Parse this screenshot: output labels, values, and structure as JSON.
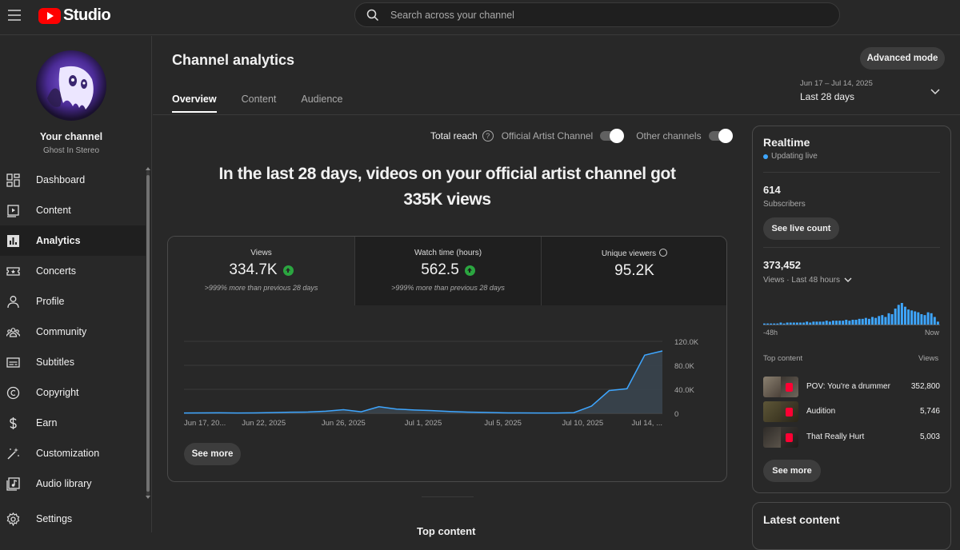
{
  "app": {
    "logo_text": "Studio",
    "search_placeholder": "Search across your channel"
  },
  "sidebar": {
    "channel_title": "Your channel",
    "channel_name": "Ghost In Stereo",
    "items": [
      {
        "label": "Dashboard",
        "icon": "dashboard-icon"
      },
      {
        "label": "Content",
        "icon": "content-icon"
      },
      {
        "label": "Analytics",
        "icon": "analytics-icon",
        "active": true
      },
      {
        "label": "Concerts",
        "icon": "ticket-icon"
      },
      {
        "label": "Profile",
        "icon": "person-icon"
      },
      {
        "label": "Community",
        "icon": "community-icon"
      },
      {
        "label": "Subtitles",
        "icon": "subtitles-icon"
      },
      {
        "label": "Copyright",
        "icon": "copyright-icon"
      },
      {
        "label": "Earn",
        "icon": "dollar-icon"
      },
      {
        "label": "Customization",
        "icon": "magic-wand-icon"
      },
      {
        "label": "Audio library",
        "icon": "audio-library-icon"
      }
    ],
    "settings_label": "Settings"
  },
  "header": {
    "title": "Channel analytics",
    "tabs": [
      "Overview",
      "Content",
      "Audience"
    ],
    "advanced_mode": "Advanced mode",
    "date_range_sub": "Jun 17 – Jul 14, 2025",
    "date_range_main": "Last 28 days"
  },
  "reach": {
    "total_reach": "Total reach",
    "official_artist_channel": "Official Artist Channel",
    "other_channels": "Other channels",
    "official_on": true,
    "other_on": true
  },
  "headline": "In the last 28 days, videos on your official artist channel got 335K views",
  "metrics": [
    {
      "label": "Views",
      "value": "334.7K",
      "note": ">999% more than previous 28 days",
      "trend": "up"
    },
    {
      "label": "Watch time (hours)",
      "value": "562.5",
      "note": ">999% more than previous 28 days",
      "trend": "up"
    },
    {
      "label": "Unique viewers",
      "value": "95.2K",
      "note": "",
      "trend": "none"
    }
  ],
  "chart_data": {
    "type": "area",
    "series": [
      {
        "values": [
          500,
          600,
          800,
          500,
          600,
          1200,
          1800,
          2100,
          3500,
          6000,
          2500,
          11000,
          7000,
          5500,
          4500,
          3000,
          2000,
          1500,
          800,
          600,
          500,
          500,
          1000,
          12000,
          38000,
          41000,
          97000,
          104000
        ]
      }
    ],
    "x_tick_labels": [
      "Jun 17, 20...",
      "Jun 22, 2025",
      "Jun 26, 2025",
      "Jul 1, 2025",
      "Jul 5, 2025",
      "Jul 10, 2025",
      "Jul 14, ..."
    ],
    "y_tick_labels": [
      "120.0K",
      "80.0K",
      "40.0K",
      "0"
    ],
    "ylim": [
      0,
      120000
    ],
    "line_color": "#3ea6ff",
    "grid": true
  },
  "card": {
    "see_more": "See more"
  },
  "realtime": {
    "title": "Realtime",
    "status": "Updating live",
    "subscribers": "614",
    "subscribers_label": "Subscribers",
    "see_live_count": "See live count",
    "views": "373,452",
    "views_label": "Views · Last 48 hours",
    "bars": [
      2,
      2,
      2,
      2,
      2,
      3,
      2,
      3,
      3,
      3,
      3,
      3,
      3,
      4,
      3,
      4,
      4,
      4,
      4,
      5,
      4,
      5,
      5,
      5,
      5,
      6,
      5,
      6,
      6,
      7,
      7,
      8,
      7,
      9,
      8,
      10,
      11,
      9,
      13,
      12,
      18,
      22,
      24,
      20,
      17,
      16,
      15,
      14,
      12,
      11,
      14,
      13,
      9,
      4
    ],
    "axis_left": "-48h",
    "axis_right": "Now",
    "top_content_label": "Top content",
    "views_col_label": "Views",
    "top_content": [
      {
        "title": "POV: You're a drummer",
        "views": "352,800"
      },
      {
        "title": "Audition",
        "views": "5,746"
      },
      {
        "title": "That Really Hurt",
        "views": "5,003"
      }
    ],
    "see_more": "See more"
  },
  "latest": {
    "title": "Latest content"
  },
  "below": {
    "top_content_title": "Top content"
  }
}
